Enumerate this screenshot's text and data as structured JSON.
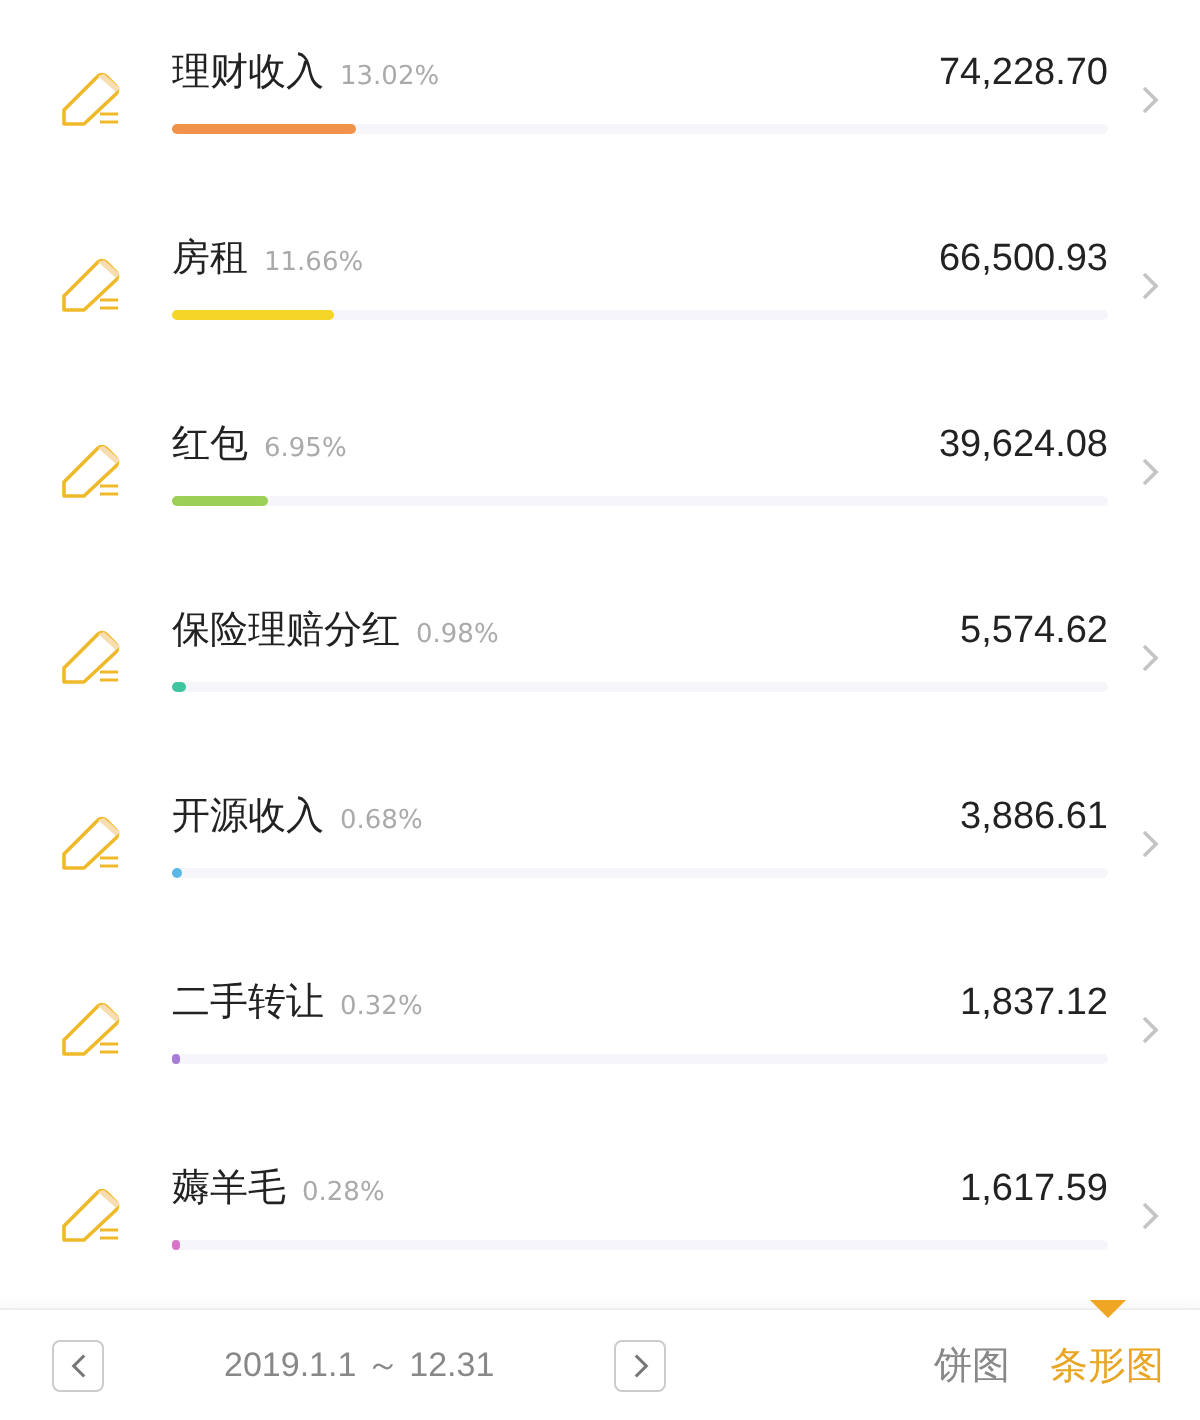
{
  "items": [
    {
      "name": "理财收入",
      "percent": "13.02%",
      "amount": "74,228.70",
      "level": 0.196,
      "color": "#f0924a"
    },
    {
      "name": "房租",
      "percent": "11.66%",
      "amount": "66,500.93",
      "level": 0.174,
      "color": "#f5d626"
    },
    {
      "name": "红包",
      "percent": "6.95%",
      "amount": "39,624.08",
      "level": 0.103,
      "color": "#9ccf55"
    },
    {
      "name": "保险理赔分红",
      "percent": "0.98%",
      "amount": "5,574.62",
      "level": 0.014,
      "color": "#3fc6a0"
    },
    {
      "name": "开源收入",
      "percent": "0.68%",
      "amount": "3,886.61",
      "level": 0.01,
      "color": "#5bb8e6"
    },
    {
      "name": "二手转让",
      "percent": "0.32%",
      "amount": "1,837.12",
      "level": 0.006,
      "color": "#a77bd6"
    },
    {
      "name": "薅羊毛",
      "percent": "0.28%",
      "amount": "1,617.59",
      "level": 0.006,
      "color": "#d774c9"
    }
  ],
  "footer": {
    "date_range": "2019.1.1 ～ 12.31",
    "tabs": [
      {
        "label": "饼图",
        "selected": false
      },
      {
        "label": "条形图",
        "selected": true
      }
    ]
  }
}
